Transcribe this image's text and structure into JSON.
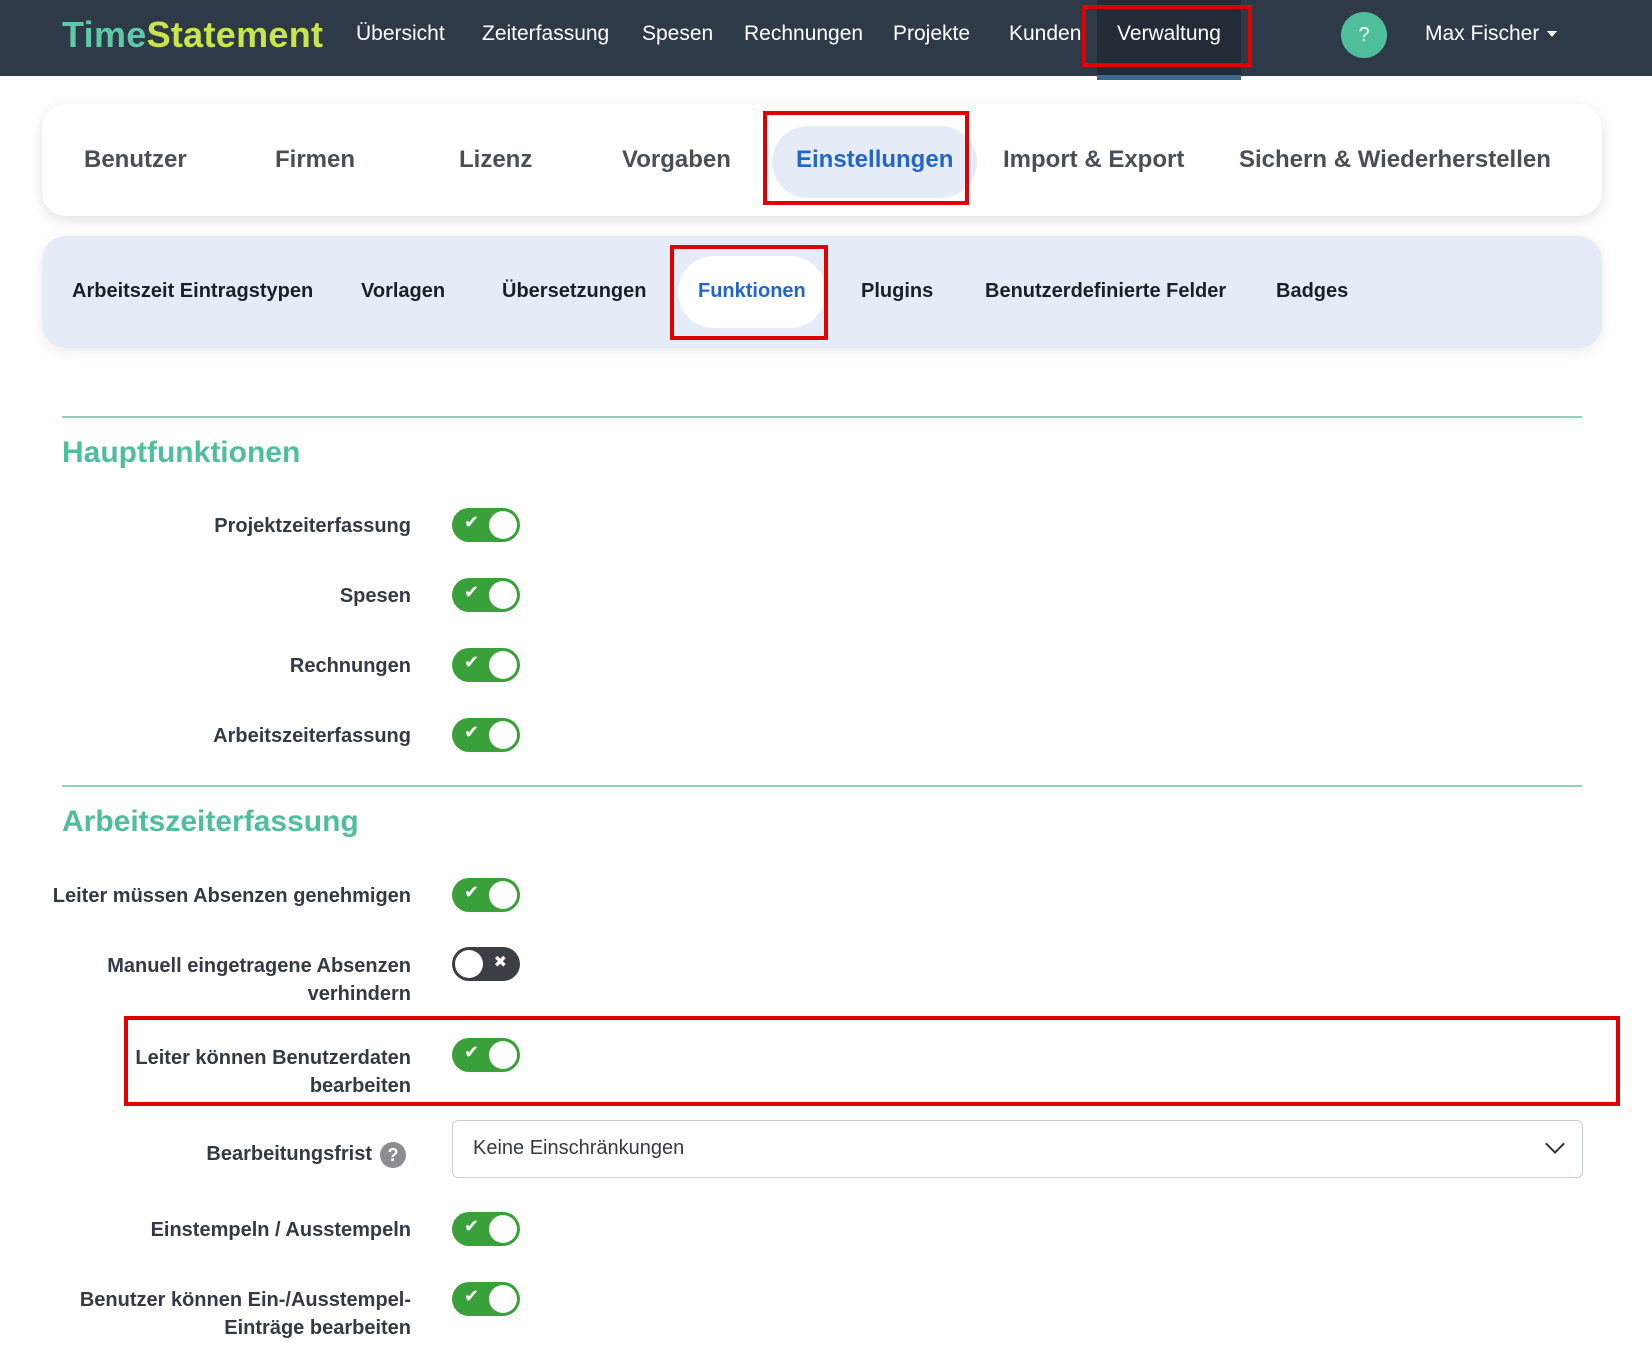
{
  "brand": {
    "part1": "Time",
    "part2": "Statement"
  },
  "topnav": {
    "items": [
      "Übersicht",
      "Zeiterfassung",
      "Spesen",
      "Rechnungen",
      "Projekte",
      "Kunden",
      "Verwaltung"
    ],
    "active": "Verwaltung",
    "help_label": "?",
    "user_name": "Max Fischer"
  },
  "admin_tabs": {
    "items": [
      "Benutzer",
      "Firmen",
      "Lizenz",
      "Vorgaben",
      "Einstellungen",
      "Import & Export",
      "Sichern & Wiederherstellen"
    ],
    "active": "Einstellungen"
  },
  "settings_tabs": {
    "items": [
      "Arbeitszeit Eintragstypen",
      "Vorlagen",
      "Übersetzungen",
      "Funktionen",
      "Plugins",
      "Benutzerdefinierte Felder",
      "Badges"
    ],
    "active": "Funktionen"
  },
  "sections": [
    {
      "title": "Hauptfunktionen",
      "settings": [
        {
          "label": "Projektzeiterfassung",
          "enabled": true
        },
        {
          "label": "Spesen",
          "enabled": true
        },
        {
          "label": "Rechnungen",
          "enabled": true
        },
        {
          "label": "Arbeitszeiterfassung",
          "enabled": true
        }
      ]
    },
    {
      "title": "Arbeitszeiterfassung",
      "settings": [
        {
          "label": "Leiter müssen Absenzen genehmigen",
          "enabled": true
        },
        {
          "label_line1": "Manuell eingetragene Absenzen",
          "label_line2": "verhindern",
          "enabled": false
        },
        {
          "label_line1": "Leiter können Benutzerdaten",
          "label_line2": "bearbeiten",
          "enabled": true
        },
        {
          "label": "Bearbeitungsfrist",
          "help": "?",
          "select_value": "Keine Einschränkungen"
        },
        {
          "label": "Einstempeln / Ausstempeln",
          "enabled": true
        },
        {
          "label_line1": "Benutzer können Ein-/Ausstempel-",
          "label_line2": "Einträge bearbeiten",
          "enabled": true
        }
      ]
    }
  ],
  "toggle_marks": {
    "on": "✔",
    "off": "✖"
  },
  "colors": {
    "nav_bg": "#2f3a48",
    "accent_green": "#4fbf9b",
    "toggle_on": "#3aa03a",
    "toggle_off": "#3b3f45",
    "active_tab_text": "#2366c9",
    "highlight": "#e00000"
  }
}
